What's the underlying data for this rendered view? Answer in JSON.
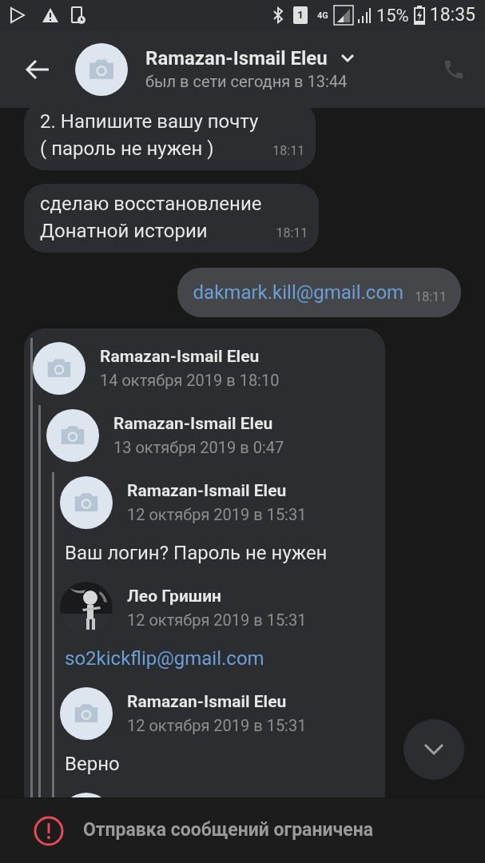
{
  "status_bar": {
    "sim_slot": "1",
    "network": "4G",
    "battery": "15%",
    "time": "18:35"
  },
  "header": {
    "name": "Ramazan-Ismail Eleu",
    "last_seen": "был в сети сегодня в 13:44"
  },
  "messages": [
    {
      "kind": "incoming",
      "lines": [
        "2. Напишите вашу почту",
        "( пароль не нужен )"
      ],
      "time": "18:11"
    },
    {
      "kind": "incoming",
      "lines": [
        "сделаю восстановление",
        "Донатной истории"
      ],
      "time": "18:11"
    },
    {
      "kind": "outgoing",
      "link": "dakmark.kill@gmail.com",
      "time": "18:11"
    },
    {
      "kind": "forwarded",
      "author": "Ramazan-Ismail Eleu",
      "date": "14 октября 2019 в 18:10",
      "forwarded": {
        "author": "Ramazan-Ismail Eleu",
        "date": "13 октября 2019 в 0:47",
        "forwarded": {
          "author": "Ramazan-Ismail Eleu",
          "date": "12 октября 2019 в 15:31",
          "entries": [
            {
              "kind": "text",
              "text": "Ваш логин? Пароль не нужен"
            },
            {
              "kind": "photo_author",
              "author": "Лео Гришин",
              "date": "12 октября 2019 в 15:31"
            },
            {
              "kind": "link",
              "text": "so2kickflip@gmail.com"
            },
            {
              "kind": "author",
              "author": "Ramazan-Ismail Eleu",
              "date": "12 октября 2019 в 15:31"
            },
            {
              "kind": "text",
              "text": "Верно"
            },
            {
              "kind": "author"
            }
          ]
        }
      }
    }
  ],
  "footer": {
    "notice": "Отправка сообщений ограничена"
  }
}
